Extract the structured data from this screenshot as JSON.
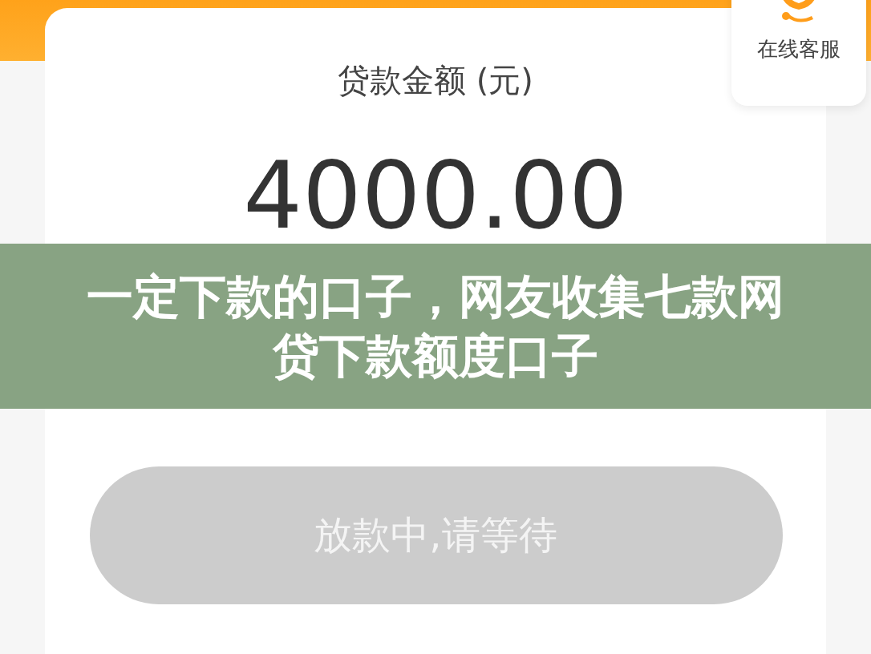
{
  "amount_card": {
    "label": "贷款金额 (元)",
    "amount": "4000.00"
  },
  "customer_service": {
    "label": "在线客服"
  },
  "banner": {
    "title": "一定下款的口子，网友收集七款网贷下款额度口子"
  },
  "action_button": {
    "label": "放款中,请等待",
    "disabled": true
  }
}
